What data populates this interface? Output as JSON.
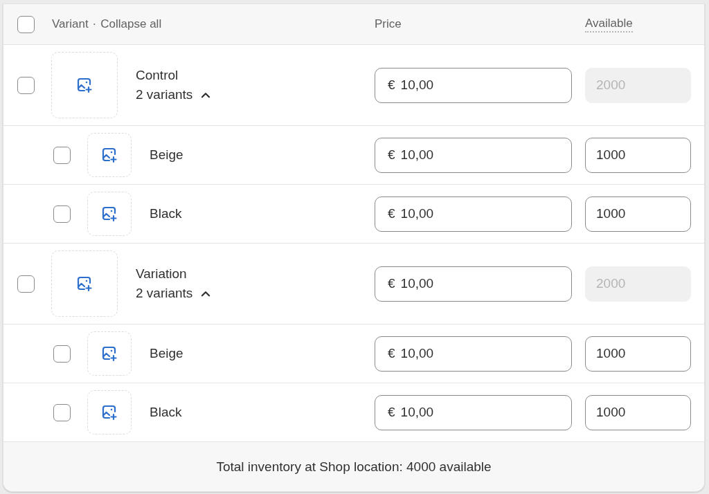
{
  "header": {
    "select_all_checked": false,
    "variant_label": "Variant",
    "separator": "·",
    "collapse_label": "Collapse all",
    "price_label": "Price",
    "available_label": "Available"
  },
  "groups": [
    {
      "name": "Control",
      "checked": false,
      "variants_count": "2 variants",
      "expanded": true,
      "currency": "€",
      "price": "10,00",
      "available": "2000",
      "disabled": true,
      "children": [
        {
          "name": "Beige",
          "checked": false,
          "currency": "€",
          "price": "10,00",
          "available": "1000",
          "disabled": false
        },
        {
          "name": "Black",
          "checked": false,
          "currency": "€",
          "price": "10,00",
          "available": "1000",
          "disabled": false
        }
      ]
    },
    {
      "name": "Variation",
      "checked": false,
      "variants_count": "2 variants",
      "expanded": true,
      "currency": "€",
      "price": "10,00",
      "available": "2000",
      "disabled": true,
      "children": [
        {
          "name": "Beige",
          "checked": false,
          "currency": "€",
          "price": "10,00",
          "available": "1000",
          "disabled": false
        },
        {
          "name": "Black",
          "checked": false,
          "currency": "€",
          "price": "10,00",
          "available": "1000",
          "disabled": false
        }
      ]
    }
  ],
  "footer": "Total inventory at Shop location: 4000 available"
}
